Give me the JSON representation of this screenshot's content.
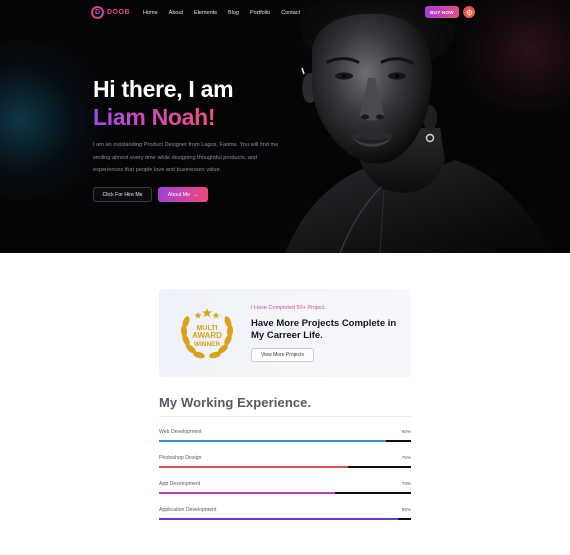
{
  "header": {
    "logo_letter": "D",
    "logo_text": "DOOB",
    "nav": [
      "Home",
      "About",
      "Elements",
      "Blog",
      "Portfolio",
      "Contact"
    ],
    "buy_label": "BUY NOW"
  },
  "hero": {
    "greeting": "Hi there, I am",
    "name": "Liam Noah!",
    "description": "I am an outstanding Product Designer from Lagos, Fatima. You will find me smiling almost every time while designing thoughtful products, and experiences that people love and businesses value.",
    "hire_label": "Click For Hire Me",
    "about_label": "About Me",
    "about_arrow": "→"
  },
  "award": {
    "badge_line1": "MULTI",
    "badge_line2": "AWARD",
    "badge_line3": "WINNER",
    "kicker": "I Have Completed 50+ Project.",
    "title": "Have More Projects Complete in My Carreer Life.",
    "button_label": "View More Projects"
  },
  "experience": {
    "title": "My Working Experience.",
    "skills": [
      {
        "label": "Web Development",
        "percent_label": "90%",
        "value": 90,
        "color": "#2f91d6"
      },
      {
        "label": "Photoshop Design",
        "percent_label": "75%",
        "value": 75,
        "color": "#e0505a"
      },
      {
        "label": "App Development",
        "percent_label": "70%",
        "value": 70,
        "color": "#c23ab8"
      },
      {
        "label": "Application Development",
        "percent_label": "95%",
        "value": 95,
        "color": "#6b3bd6"
      }
    ]
  },
  "colors": {
    "accent_purple": "#a33fd6",
    "accent_pink": "#e84a85",
    "gold": "#d9a21a"
  }
}
